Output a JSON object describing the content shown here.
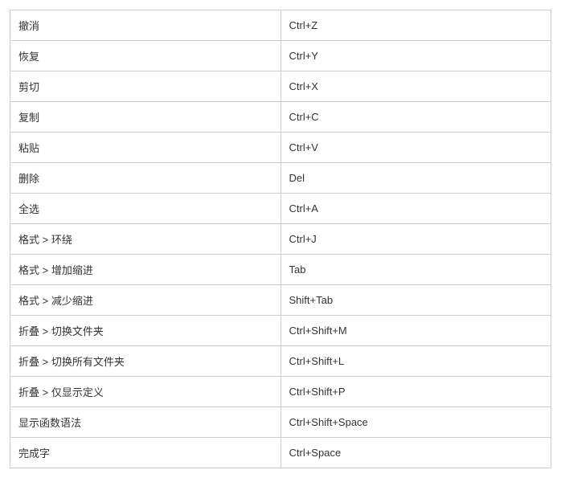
{
  "shortcuts": [
    {
      "action": "撤消",
      "shortcut": "Ctrl+Z"
    },
    {
      "action": "恢复",
      "shortcut": "Ctrl+Y"
    },
    {
      "action": "剪切",
      "shortcut": "Ctrl+X"
    },
    {
      "action": "复制",
      "shortcut": "Ctrl+C"
    },
    {
      "action": "粘贴",
      "shortcut": "Ctrl+V"
    },
    {
      "action": "删除",
      "shortcut": "Del"
    },
    {
      "action": "全选",
      "shortcut": "Ctrl+A"
    },
    {
      "action": "格式 > 环绕",
      "shortcut": "Ctrl+J"
    },
    {
      "action": "格式 > 增加缩进",
      "shortcut": "Tab"
    },
    {
      "action": "格式 > 减少缩进",
      "shortcut": "Shift+Tab"
    },
    {
      "action": "折叠 > 切换文件夹",
      "shortcut": "Ctrl+Shift+M"
    },
    {
      "action": "折叠 > 切换所有文件夹",
      "shortcut": "Ctrl+Shift+L"
    },
    {
      "action": "折叠 > 仅显示定义",
      "shortcut": "Ctrl+Shift+P"
    },
    {
      "action": "显示函数语法",
      "shortcut": "Ctrl+Shift+Space"
    },
    {
      "action": "完成字",
      "shortcut": "Ctrl+Space"
    }
  ]
}
